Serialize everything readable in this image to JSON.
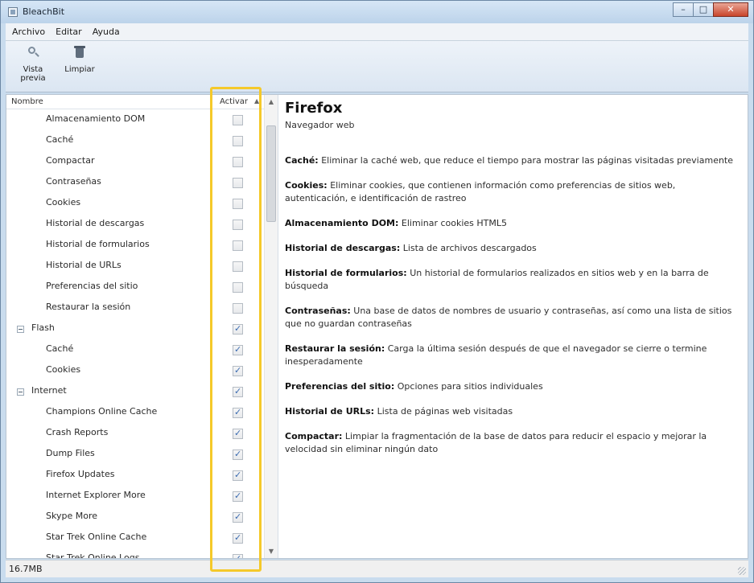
{
  "window": {
    "title": "BleachBit"
  },
  "menu": [
    "Archivo",
    "Editar",
    "Ayuda"
  ],
  "toolbar": {
    "preview_label": "Vista previa",
    "clean_label": "Limpiar"
  },
  "tree": {
    "header": {
      "name": "Nombre",
      "active": "Activar"
    },
    "rows": [
      {
        "type": "child",
        "label": "Almacenamiento DOM",
        "checked": false
      },
      {
        "type": "child",
        "label": "Caché",
        "checked": false
      },
      {
        "type": "child",
        "label": "Compactar",
        "checked": false
      },
      {
        "type": "child",
        "label": "Contraseñas",
        "checked": false
      },
      {
        "type": "child",
        "label": "Cookies",
        "checked": false
      },
      {
        "type": "child",
        "label": "Historial de descargas",
        "checked": false
      },
      {
        "type": "child",
        "label": "Historial de formularios",
        "checked": false
      },
      {
        "type": "child",
        "label": "Historial de URLs",
        "checked": false
      },
      {
        "type": "child",
        "label": "Preferencias del sitio",
        "checked": false
      },
      {
        "type": "child",
        "label": "Restaurar la sesión",
        "checked": false
      },
      {
        "type": "group",
        "label": "Flash",
        "checked": true
      },
      {
        "type": "child",
        "label": "Caché",
        "checked": true
      },
      {
        "type": "child",
        "label": "Cookies",
        "checked": true
      },
      {
        "type": "group",
        "label": "Internet",
        "checked": true
      },
      {
        "type": "child",
        "label": "Champions Online Cache",
        "checked": true
      },
      {
        "type": "child",
        "label": "Crash Reports",
        "checked": true
      },
      {
        "type": "child",
        "label": "Dump Files",
        "checked": true
      },
      {
        "type": "child",
        "label": "Firefox Updates",
        "checked": true
      },
      {
        "type": "child",
        "label": "Internet Explorer More",
        "checked": true
      },
      {
        "type": "child",
        "label": "Skype More",
        "checked": true
      },
      {
        "type": "child",
        "label": "Star Trek Online Cache",
        "checked": true
      },
      {
        "type": "child",
        "label": "Star Trek Online Logs",
        "checked": true
      }
    ]
  },
  "detail": {
    "title": "Firefox",
    "subtitle": "Navegador web",
    "items": [
      {
        "term": "Caché:",
        "text": "Eliminar la caché web, que reduce el tiempo para mostrar las páginas visitadas previamente"
      },
      {
        "term": "Cookies:",
        "text": "Eliminar cookies, que contienen información como preferencias de sitios web, autenticación, e identificación de rastreo"
      },
      {
        "term": "Almacenamiento DOM:",
        "text": "Eliminar cookies HTML5"
      },
      {
        "term": "Historial de descargas:",
        "text": "Lista de archivos descargados"
      },
      {
        "term": "Historial de formularios:",
        "text": "Un historial de formularios realizados en sitios web y en la barra de búsqueda"
      },
      {
        "term": "Contraseñas:",
        "text": "Una base de datos de nombres de usuario y contraseñas, así como  una lista de sitios que no guardan contraseñas"
      },
      {
        "term": "Restaurar la sesión:",
        "text": "Carga la última sesión después de que el navegador se cierre o termine inesperadamente"
      },
      {
        "term": "Preferencias del sitio:",
        "text": "Opciones para sitios individuales"
      },
      {
        "term": "Historial de URLs:",
        "text": "Lista de páginas web visitadas"
      },
      {
        "term": "Compactar:",
        "text": "Limpiar la fragmentación de la base de datos para reducir el espacio y mejorar la velocidad sin eliminar ningún dato"
      }
    ]
  },
  "status": {
    "text": "16.7MB"
  },
  "colors": {
    "highlight": "#f5c92a",
    "checkmark": "#3a6bb0"
  },
  "icons": {
    "preview": "magnifier-icon",
    "clean": "trash-bin-icon"
  }
}
